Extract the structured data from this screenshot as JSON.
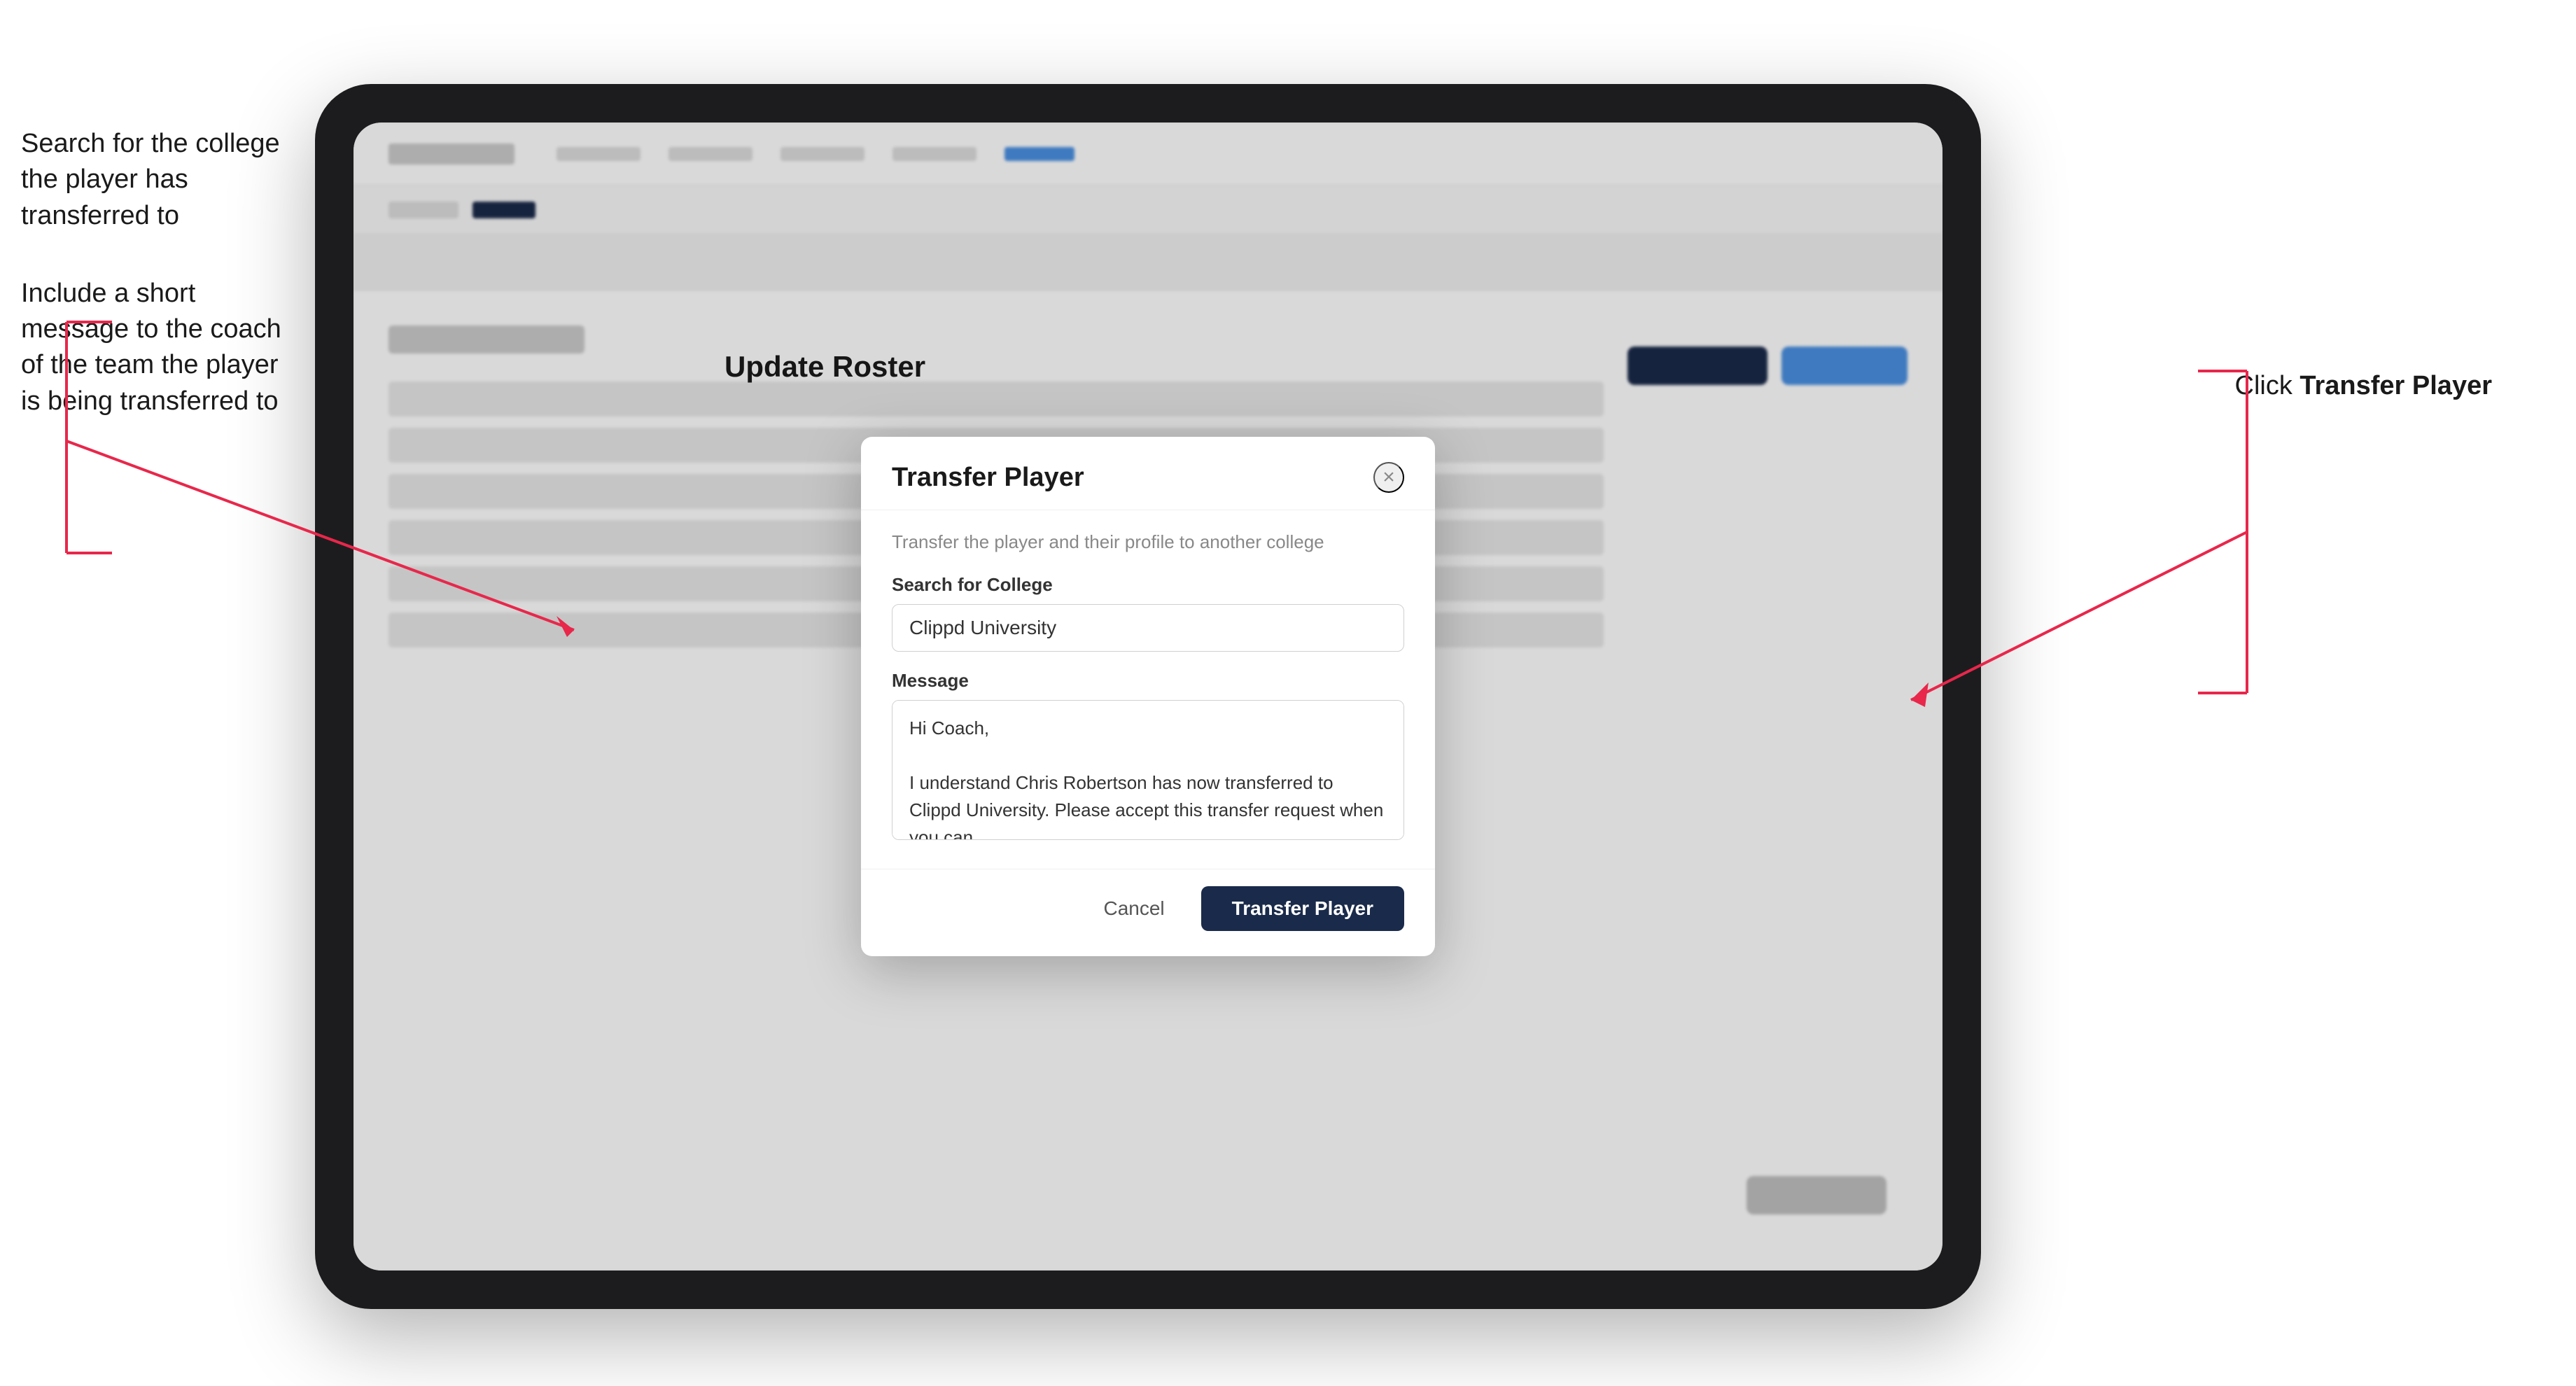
{
  "annotations": {
    "left_top": "Search for the college the player has transferred to",
    "left_bottom": "Include a short message to the coach of the team the player is being transferred to",
    "right": "Click",
    "right_bold": "Transfer Player"
  },
  "tablet": {
    "page_title": "Update Roster"
  },
  "modal": {
    "title": "Transfer Player",
    "close_label": "×",
    "description": "Transfer the player and their profile to another college",
    "search_label": "Search for College",
    "search_value": "Clippd University",
    "message_label": "Message",
    "message_value": "Hi Coach,\n\nI understand Chris Robertson has now transferred to Clippd University. Please accept this transfer request when you can.",
    "cancel_label": "Cancel",
    "transfer_label": "Transfer Player"
  }
}
